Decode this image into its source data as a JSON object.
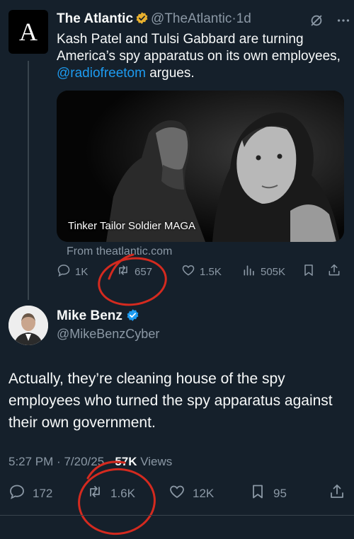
{
  "quoted": {
    "avatar_letter": "A",
    "author_name": "The Atlantic",
    "handle": "@TheAtlantic",
    "separator": "·",
    "time": "1d",
    "text_before_link": "Kash Patel and Tulsi Gabbard are turning America’s spy apparatus on its own employees, ",
    "mention": "@radiofreetom",
    "text_after_link": " argues.",
    "card_caption": "Tinker Tailor Soldier MAGA",
    "card_source": "From theatlantic.com",
    "stats": {
      "replies": "1K",
      "reposts": "657",
      "likes": "1.5K",
      "views": "505K"
    }
  },
  "main": {
    "author_name": "Mike Benz",
    "handle": "@MikeBenzCyber",
    "text": "Actually, they’re cleaning house of the spy employees who turned the spy apparatus against their own government.",
    "time": "5:27 PM",
    "separator": "·",
    "date": "7/20/25",
    "separator2": "·",
    "views_count": "57K",
    "views_label": "Views",
    "stats": {
      "replies": "172",
      "reposts": "1.6K",
      "likes": "12K",
      "bookmarks": "95"
    }
  },
  "colors": {
    "background": "#15202b",
    "text": "#f7f9f9",
    "muted": "#8b98a5",
    "link": "#1d9bf0",
    "annotation": "#d42a1f",
    "verified_gold": "#e8b02e",
    "verified_blue": "#1d9bf0"
  }
}
